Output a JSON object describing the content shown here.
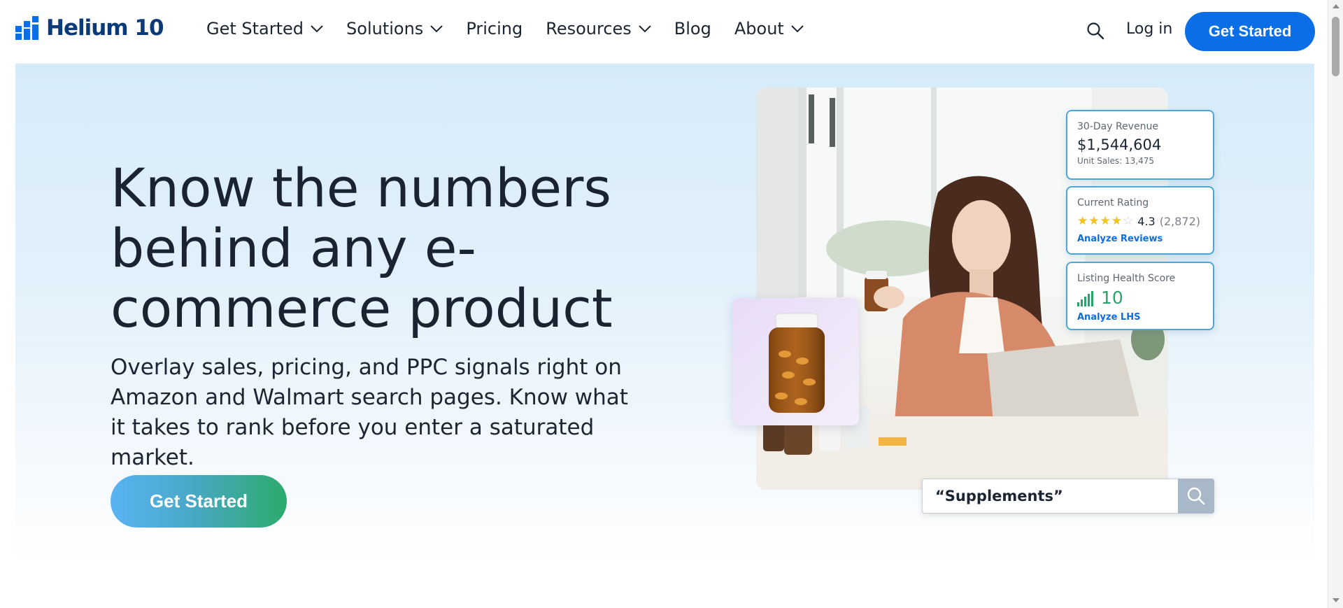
{
  "brand": {
    "name": "Helium 10"
  },
  "nav": {
    "items": [
      {
        "label": "Get Started",
        "has_dropdown": true
      },
      {
        "label": "Solutions",
        "has_dropdown": true
      },
      {
        "label": "Pricing",
        "has_dropdown": false
      },
      {
        "label": "Resources",
        "has_dropdown": true
      },
      {
        "label": "Blog",
        "has_dropdown": false
      },
      {
        "label": "About",
        "has_dropdown": true
      }
    ],
    "login_label": "Log in",
    "cta_label": "Get Started"
  },
  "hero": {
    "headline": "Know the numbers behind any e-commerce product",
    "subtext": "Overlay sales, pricing, and PPC signals right on Amazon and Walmart search pages. Know what it takes to rank before you enter a saturated market.",
    "cta_label": "Get Started"
  },
  "metrics": {
    "revenue": {
      "label": "30-Day Revenue",
      "value": "$1,544,604",
      "sub": "Unit Sales: 13,475"
    },
    "rating": {
      "label": "Current Rating",
      "stars": 4,
      "max_stars": 5,
      "value": "4.3",
      "count": "(2,872)",
      "link": "Analyze Reviews"
    },
    "lhs": {
      "label": "Listing Health Score",
      "value": "10",
      "link": "Analyze LHS"
    }
  },
  "search": {
    "query": "“Supplements”"
  },
  "colors": {
    "brand_blue": "#0a6ee6",
    "logo_navy": "#0b3a78",
    "lhs_green": "#2aa36a",
    "star_gold": "#f4c21a"
  },
  "icons": [
    "logo-icon",
    "chevron-down-icon",
    "search-icon",
    "star-icon",
    "signal-bars-icon"
  ]
}
